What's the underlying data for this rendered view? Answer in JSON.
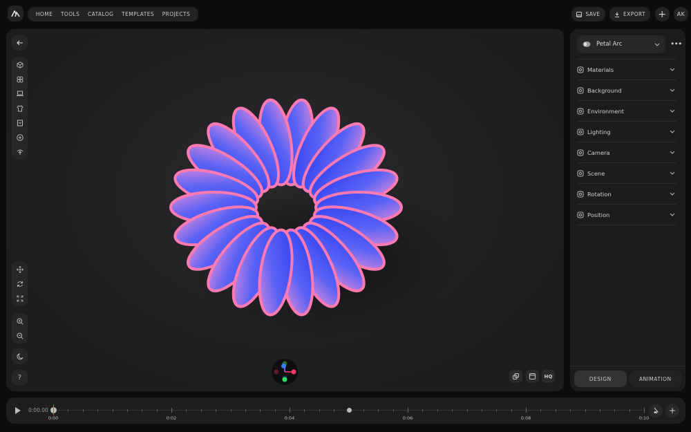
{
  "nav": {
    "items": [
      "HOME",
      "TOOLS",
      "CATALOG",
      "TEMPLATES",
      "PROJECTS"
    ]
  },
  "toolbar": {
    "save": "SAVE",
    "export": "EXPORT",
    "avatar": "AK"
  },
  "panel": {
    "object": "Petal Arc",
    "sections": [
      "Materials",
      "Background",
      "Environment",
      "Lighting",
      "Camera",
      "Scene",
      "Rotation",
      "Position"
    ],
    "tabs": [
      "DESIGN",
      "ANIMATION"
    ],
    "active_tab": "DESIGN"
  },
  "viewport": {
    "hq": "HQ",
    "tools": [
      "cube-icon",
      "components-icon",
      "laptop-icon",
      "shirt-icon",
      "package-icon",
      "add-circle-icon",
      "upload-icon"
    ],
    "nav_tools": [
      "move-icon",
      "orbit-icon",
      "fit-icon",
      "zoom-in-icon",
      "zoom-out-icon",
      "dark-mode-icon",
      "help-icon"
    ]
  },
  "timeline": {
    "current": "0:00.00",
    "labels": [
      "0:00",
      "0:02",
      "0:04",
      "0:06",
      "0:08",
      "0:10"
    ],
    "playhead_seconds": 0,
    "keyframe_seconds": 5,
    "duration_seconds": 10
  },
  "colors": {
    "petal_blue": "#2a35e8",
    "petal_pink": "#ff7ab0",
    "playhead": "#ff3b4a"
  }
}
